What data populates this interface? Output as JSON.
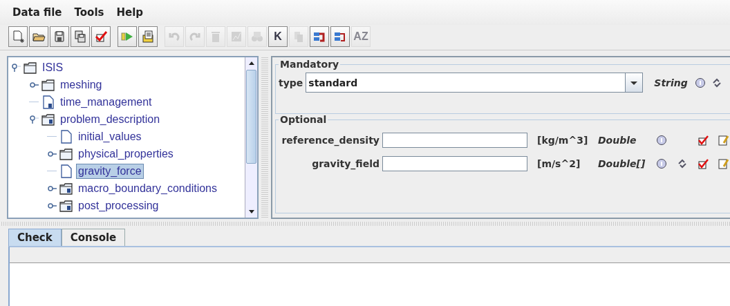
{
  "menu": [
    "Data file",
    "Tools",
    "Help"
  ],
  "toolbar": [
    [
      {
        "kind": "new",
        "disabled": false
      },
      {
        "kind": "open",
        "disabled": false
      },
      {
        "kind": "save",
        "disabled": false
      },
      {
        "kind": "save-all",
        "disabled": false
      },
      {
        "kind": "check",
        "disabled": false
      }
    ],
    [
      {
        "kind": "run",
        "disabled": false
      },
      {
        "kind": "report",
        "disabled": false
      }
    ],
    [
      {
        "kind": "undo",
        "disabled": true
      },
      {
        "kind": "redo",
        "disabled": true
      },
      {
        "kind": "delete",
        "disabled": true
      },
      {
        "kind": "chart",
        "disabled": true
      },
      {
        "kind": "binoculars",
        "disabled": true
      },
      {
        "kind": "letter",
        "glyph": "K",
        "disabled": false
      },
      {
        "kind": "copy",
        "disabled": true
      },
      {
        "kind": "move-up",
        "disabled": false
      },
      {
        "kind": "move-down",
        "disabled": false
      },
      {
        "kind": "letter",
        "glyph": "AZ",
        "disabled": true
      }
    ]
  ],
  "tree": [
    {
      "label": "ISIS",
      "kind": "folder",
      "expanded": true,
      "selected": false,
      "children": [
        {
          "label": "meshing",
          "kind": "folder",
          "expanded": false,
          "selected": false
        },
        {
          "label": "time_management",
          "kind": "file-marked",
          "selected": false
        },
        {
          "label": "problem_description",
          "kind": "folder-marked",
          "expanded": true,
          "selected": false,
          "children": [
            {
              "label": "initial_values",
              "kind": "file",
              "selected": false
            },
            {
              "label": "physical_properties",
              "kind": "folder",
              "expanded": false,
              "selected": false
            },
            {
              "label": "gravity_force",
              "kind": "file",
              "selected": true
            },
            {
              "label": "macro_boundary_conditions",
              "kind": "folder-marked",
              "expanded": false,
              "selected": false
            },
            {
              "label": "post_processing",
              "kind": "folder-marked",
              "expanded": false,
              "selected": false
            }
          ]
        }
      ]
    }
  ],
  "mandatory": {
    "title": "Mandatory",
    "fields": [
      {
        "label": "type",
        "value": "standard",
        "type": "String",
        "info": true,
        "link": true
      }
    ]
  },
  "optional": {
    "title": "Optional",
    "fields": [
      {
        "label": "reference_density",
        "unit": "[kg/m^3]",
        "type": "Double",
        "info": true,
        "link": false,
        "check": true,
        "edit": true
      },
      {
        "label": "gravity_field",
        "unit": "[m/s^2]",
        "type": "Double[]",
        "info": true,
        "link": true,
        "check": true,
        "edit": true
      }
    ]
  },
  "tabs": [
    {
      "label": "Check",
      "selected": true
    },
    {
      "label": "Console",
      "selected": false
    }
  ]
}
